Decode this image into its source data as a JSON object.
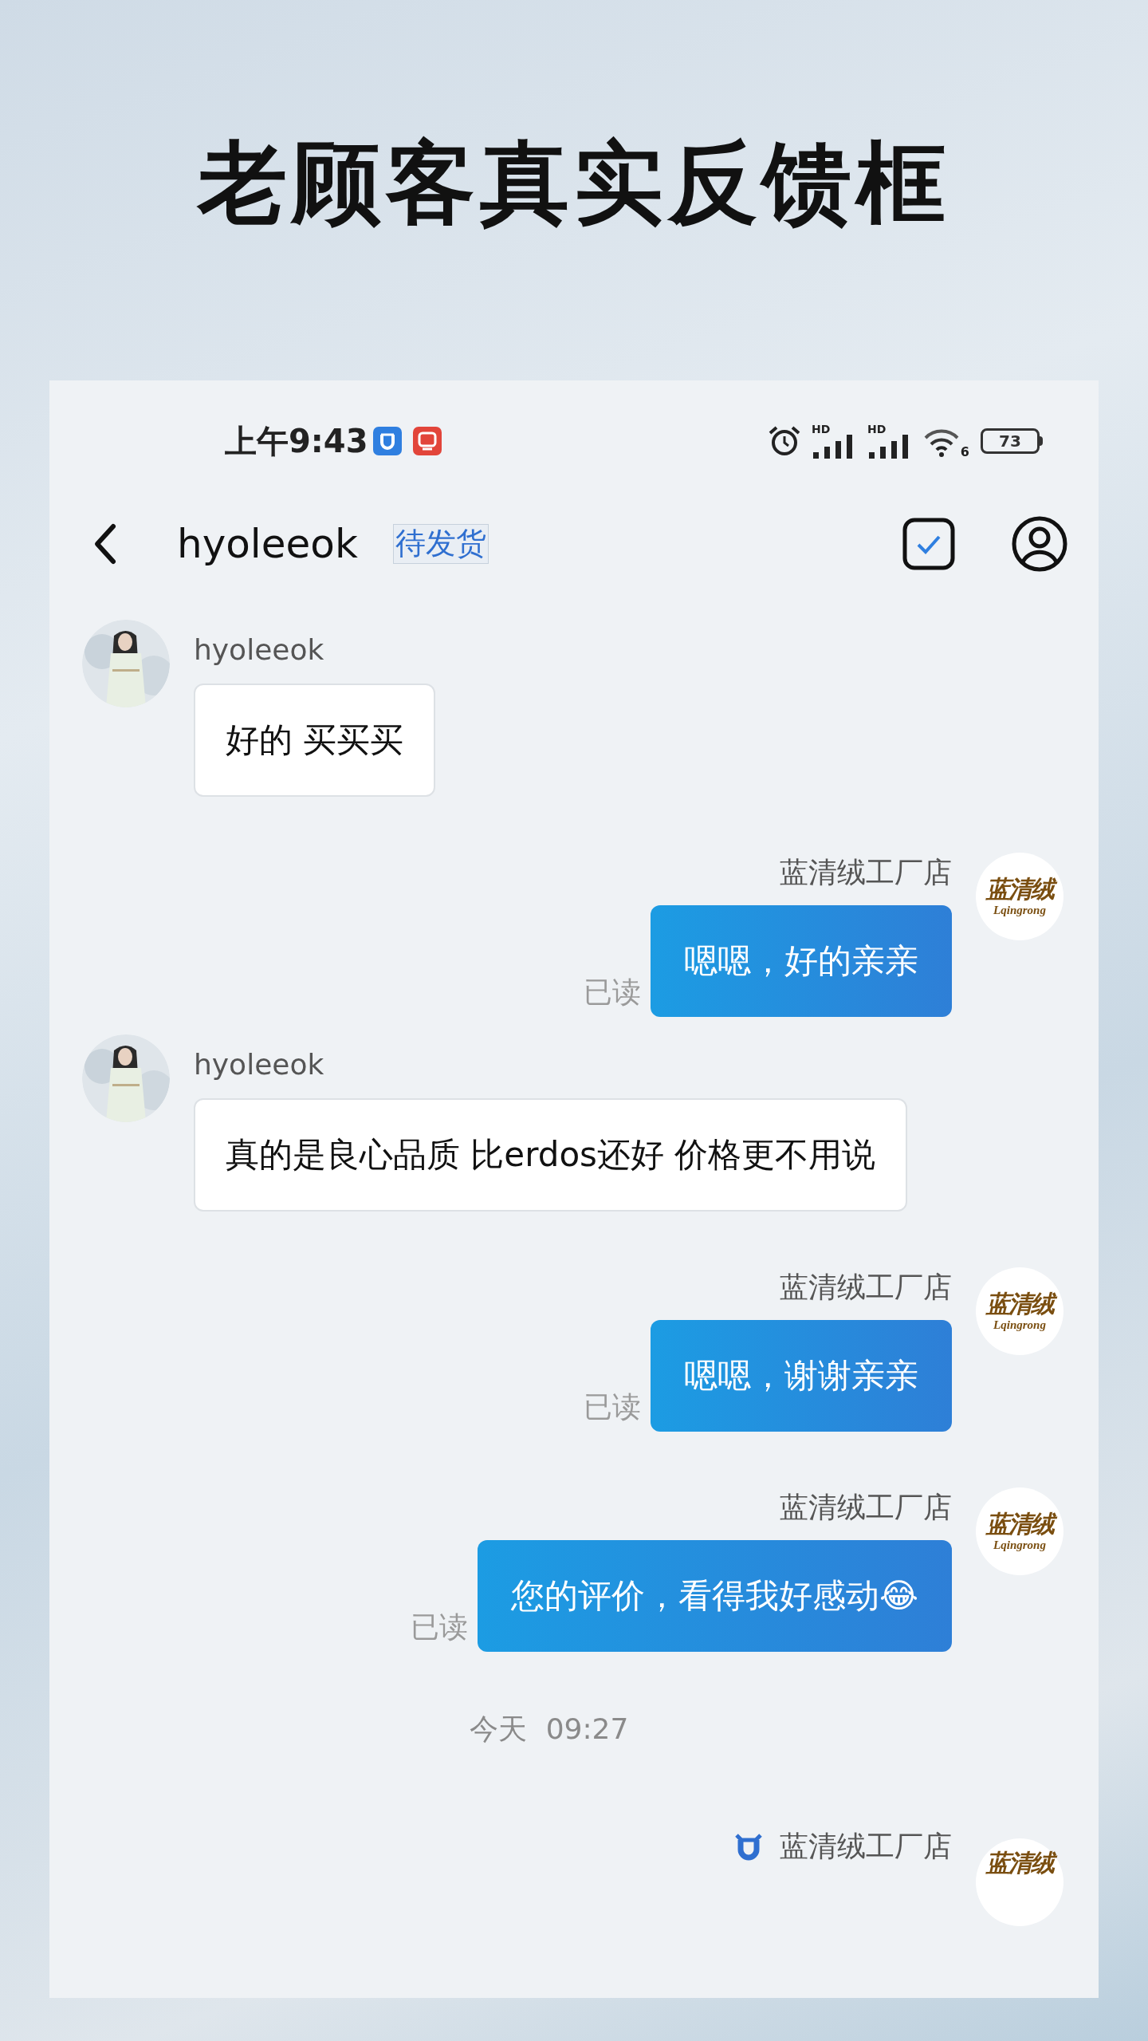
{
  "title": "老顾客真实反馈框",
  "status_bar": {
    "time": "上午9:43",
    "signals": [
      {
        "label": "HD"
      },
      {
        "label": "HD"
      }
    ],
    "wifi_label": "6",
    "battery": "73"
  },
  "header": {
    "contact": "hyoleeok",
    "tag": "待发货"
  },
  "messages": [
    {
      "kind": "received",
      "sender": "hyoleeok",
      "text": "好的 买买买"
    },
    {
      "kind": "sent",
      "sender": "蓝清绒工厂店",
      "text": "嗯嗯，好的亲亲",
      "read_label": "已读",
      "avatar_text": "蓝清绒",
      "avatar_subtext": "Lqingrong"
    },
    {
      "kind": "received",
      "sender": "hyoleeok",
      "text": "真的是良心品质 比erdos还好 价格更不用说"
    },
    {
      "kind": "sent",
      "sender": "蓝清绒工厂店",
      "text": "嗯嗯，谢谢亲亲",
      "read_label": "已读",
      "avatar_text": "蓝清绒",
      "avatar_subtext": "Lqingrong"
    },
    {
      "kind": "sent",
      "sender": "蓝清绒工厂店",
      "text": "您的评价，看得我好感动😂",
      "read_label": "已读",
      "avatar_text": "蓝清绒",
      "avatar_subtext": "Lqingrong"
    }
  ],
  "timestamp": {
    "day": "今天",
    "time": "09:27"
  },
  "last_message": {
    "sender": "蓝清绒工厂店",
    "avatar_text": "蓝清绒"
  }
}
